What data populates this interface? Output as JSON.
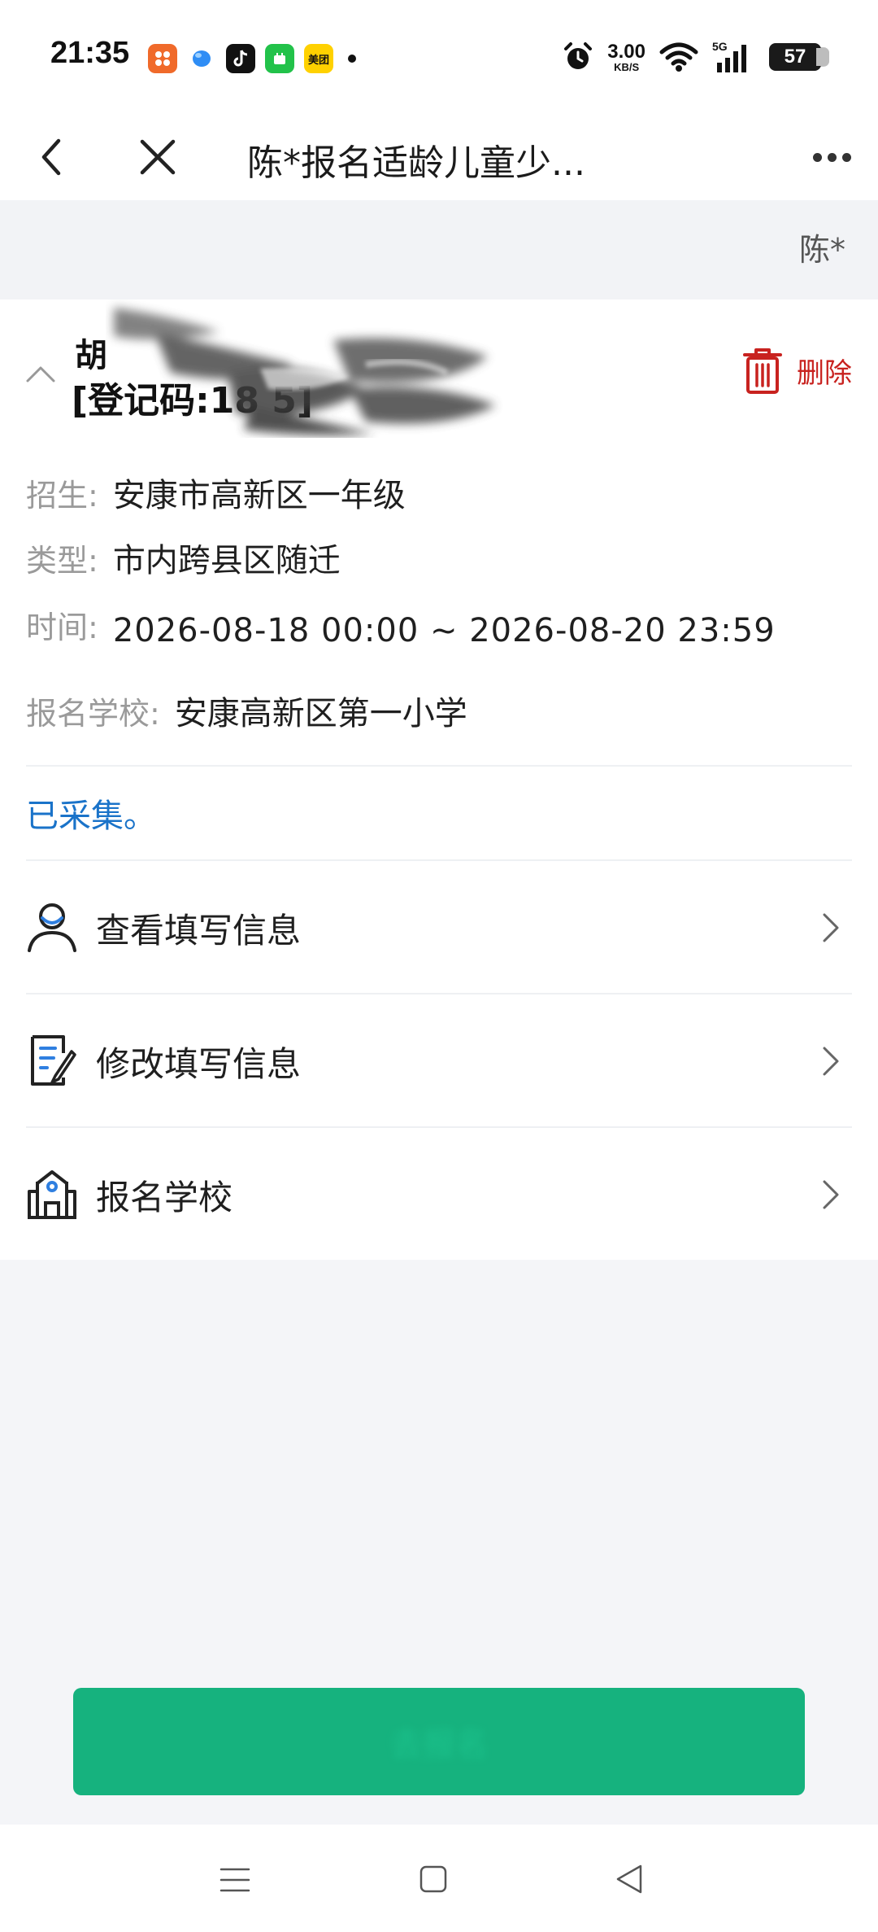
{
  "status_bar": {
    "time": "21:35",
    "apps": [
      {
        "icon": "app-orange-icon",
        "color": "#f06a2a",
        "label": ""
      },
      {
        "icon": "app-blue-bubble-icon",
        "color": "#ffffff",
        "label": ""
      },
      {
        "icon": "douyin-icon",
        "color": "#111111",
        "label": ""
      },
      {
        "icon": "app-green-icon",
        "color": "#22c24a",
        "label": ""
      },
      {
        "icon": "meituan-icon",
        "color": "#ffd100",
        "label": "美团"
      }
    ],
    "net_speed_value": "3.00",
    "net_speed_unit": "KB/S",
    "signal": "5G",
    "battery": "57"
  },
  "nav": {
    "title": "陈*报名适龄儿童少..."
  },
  "owner": {
    "name": "陈*"
  },
  "record": {
    "name": "胡",
    "code": "[登记码:18            5]",
    "delete_label": "删除",
    "fields": [
      {
        "label": "招生:",
        "value": "安康市高新区一年级"
      },
      {
        "label": "类型:",
        "value": "市内跨县区随迁"
      },
      {
        "label": "时间:",
        "value": "2026-08-18 00:00 ~ 2026-08-20 23:59"
      },
      {
        "label": "报名学校:",
        "value": "安康高新区第一小学"
      }
    ],
    "status": "已采集。"
  },
  "menu": [
    {
      "label": "查看填写信息",
      "icon": "user-icon"
    },
    {
      "label": "修改填写信息",
      "icon": "edit-document-icon"
    },
    {
      "label": "报名学校",
      "icon": "school-icon"
    }
  ],
  "bottom_button": {
    "label": "去报名"
  },
  "colors": {
    "accent_green": "#16b27e",
    "link_blue": "#1a73c9",
    "delete_red": "#c8221f"
  }
}
